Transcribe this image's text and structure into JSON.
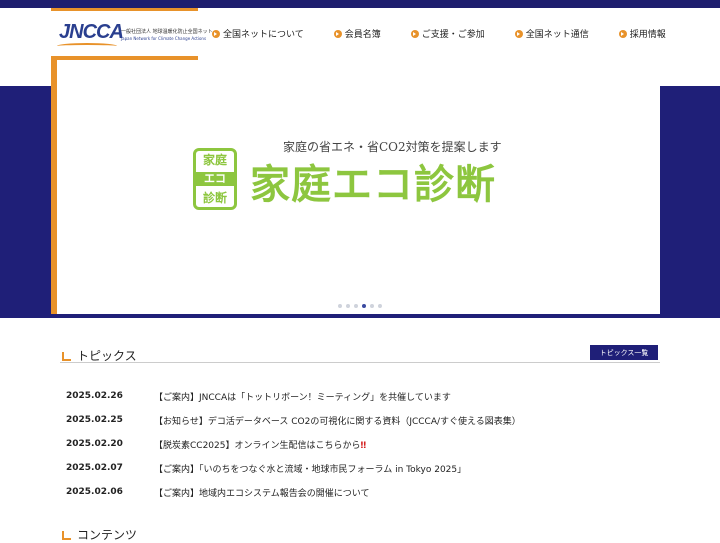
{
  "header": {
    "logo_text": "JNCCA",
    "org_name": "一般社団法人 地球温暖化防止全国ネット",
    "org_name_en": "Japan Network for Climate Change Actions"
  },
  "nav": {
    "items": [
      {
        "label": "全国ネットについて"
      },
      {
        "label": "会員名簿"
      },
      {
        "label": "ご支援・ご参加"
      },
      {
        "label": "全国ネット通信"
      },
      {
        "label": "採用情報"
      }
    ]
  },
  "hero": {
    "subtitle": "家庭の省エネ・省CO2対策を提案します",
    "badge_top": "家庭",
    "badge_mid": "エコ",
    "badge_bottom": "診断",
    "title": "家庭エコ診断",
    "slides": 6,
    "active_slide": 4
  },
  "topics": {
    "heading": "トピックス",
    "list_button": "トピックス一覧",
    "items": [
      {
        "date": "2025.02.26",
        "title": "【ご案内】JNCCAは「トットリボーン！ミーティング」を共催しています",
        "exclaim": ""
      },
      {
        "date": "2025.02.25",
        "title": "【お知らせ】デコ活データベース CO2の可視化に関する資料（JCCCA/すぐ使える図表集）",
        "exclaim": ""
      },
      {
        "date": "2025.02.20",
        "title": "【脱炭素CC2025】オンライン生配信はこちらから",
        "exclaim": "‼"
      },
      {
        "date": "2025.02.07",
        "title": "【ご案内】「いのちをつなぐ水と流域・地球市民フォーラム in Tokyo 2025」",
        "exclaim": ""
      },
      {
        "date": "2025.02.06",
        "title": "【ご案内】地域内エコシステム報告会の開催について",
        "exclaim": ""
      }
    ]
  },
  "contents": {
    "heading": "コンテンツ"
  },
  "colors": {
    "navy": "#1f1f78",
    "orange": "#e8922a",
    "green": "#8dc63f"
  }
}
